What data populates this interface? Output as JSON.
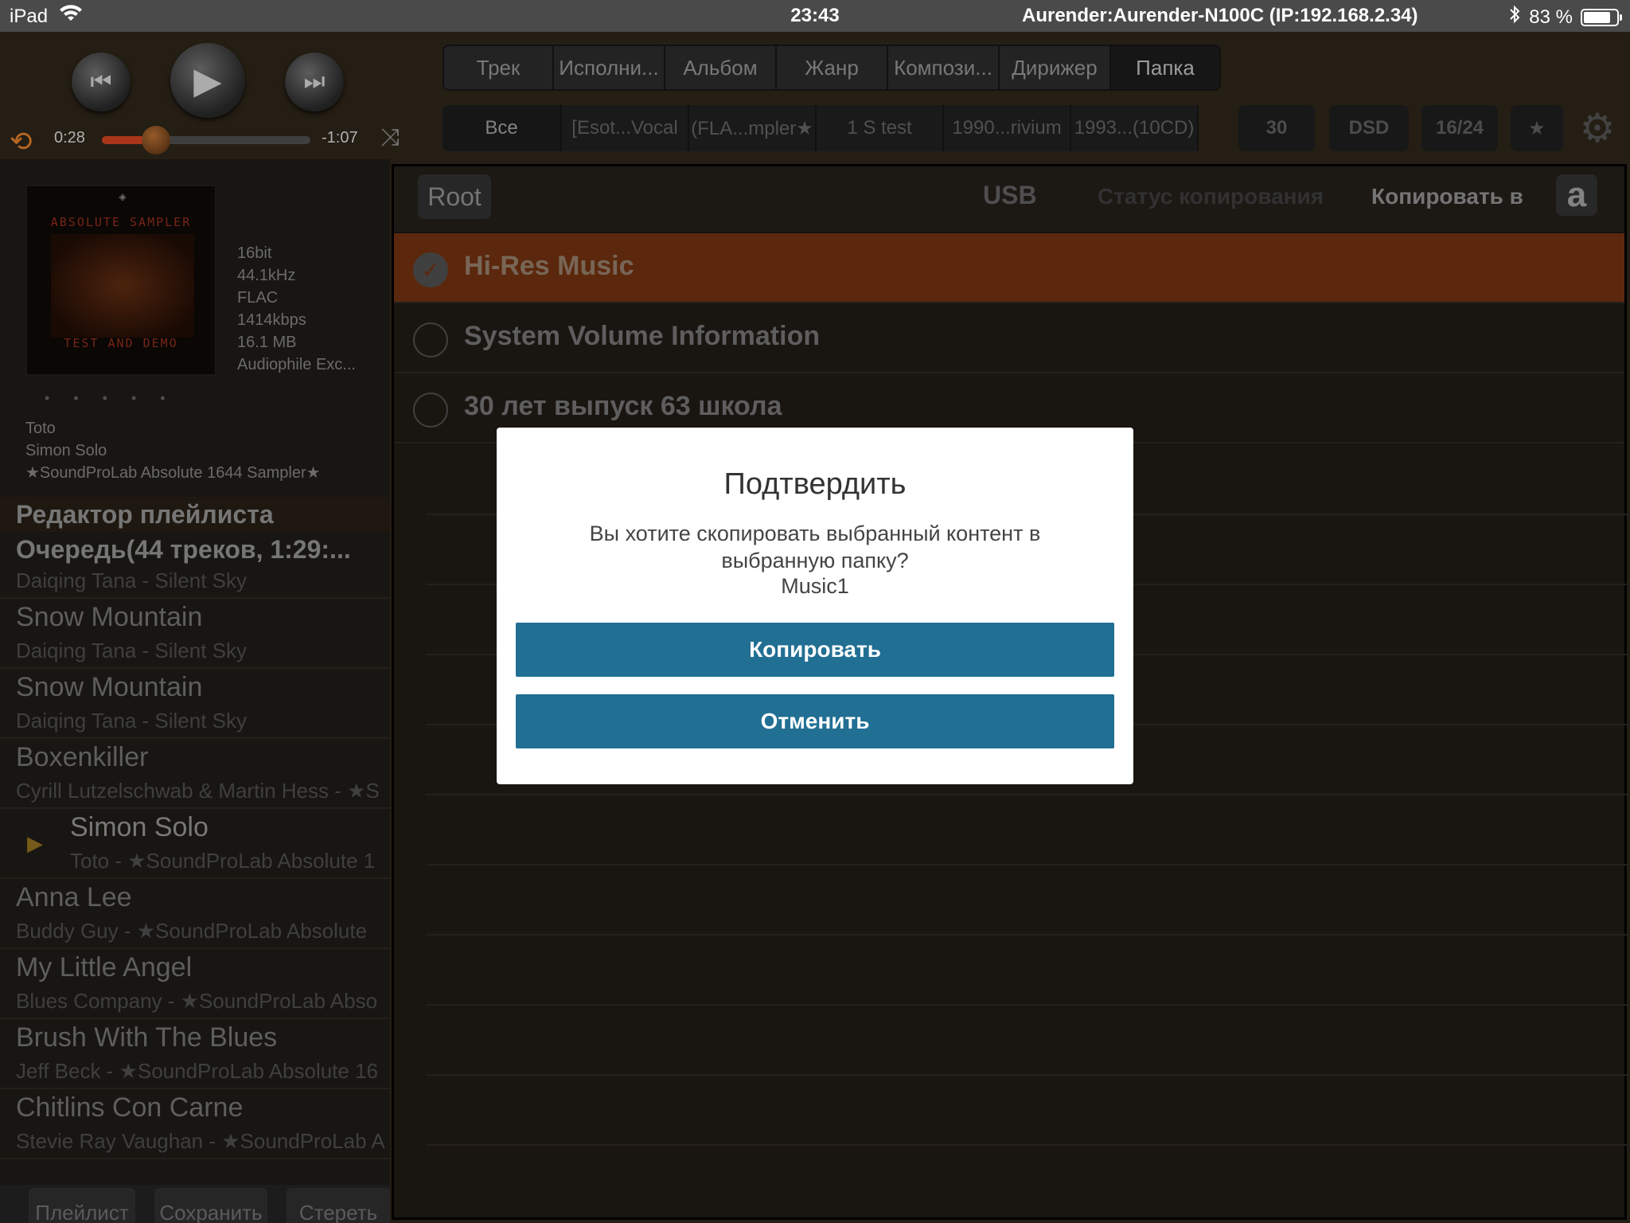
{
  "status_bar": {
    "device": "iPad",
    "time": "23:43",
    "connection": "Aurender:Aurender-N100C (IP:192.168.2.34)",
    "battery": "83 %",
    "battery_level": 0.83
  },
  "player": {
    "elapsed": "0:28",
    "remaining": "-1:07",
    "progress": 0.26
  },
  "category_tabs": [
    {
      "label": "Трек",
      "active": false
    },
    {
      "label": "Исполни...",
      "active": false
    },
    {
      "label": "Альбом",
      "active": false
    },
    {
      "label": "Жанр",
      "active": false
    },
    {
      "label": "Компози...",
      "active": false
    },
    {
      "label": "Дирижер",
      "active": false
    },
    {
      "label": "Папка",
      "active": true
    }
  ],
  "filters": {
    "items": [
      "Все",
      "[Esot...Vocal",
      "(FLA...mpler★",
      "1 S test",
      "1990...rivium",
      "1993...(10CD)"
    ],
    "badges": [
      "30",
      "DSD",
      "16/24",
      "★"
    ]
  },
  "now_playing": {
    "album_art": {
      "top_text": "ABSOLUTE SAMPLER",
      "bottom_text": "TEST AND DEMO"
    },
    "meta": [
      "16bit",
      "44.1kHz",
      "FLAC",
      "1414kbps",
      "16.1 MB",
      "Audiophile Exc..."
    ],
    "artist": "Toto",
    "title": "Simon Solo",
    "album": "★SoundProLab Absolute 1644 Sampler★"
  },
  "playlist": {
    "header": "Редактор плейлиста",
    "queue_header": "Очередь(44 треков, 1:29:...",
    "first_subtitle": "Daiqing Tana - Silent Sky",
    "tracks": [
      {
        "title": "Snow Mountain",
        "subtitle": "Daiqing Tana - Silent Sky",
        "playing": false
      },
      {
        "title": "Snow Mountain",
        "subtitle": "Daiqing Tana - Silent Sky",
        "playing": false
      },
      {
        "title": "Boxenkiller",
        "subtitle": "Cyrill Lutzelschwab & Martin Hess - ★S",
        "playing": false
      },
      {
        "title": "Simon Solo",
        "subtitle": "Toto - ★SoundProLab Absolute 1",
        "playing": true
      },
      {
        "title": "Anna Lee",
        "subtitle": "Buddy Guy - ★SoundProLab Absolute",
        "playing": false
      },
      {
        "title": "My Little Angel",
        "subtitle": "Blues Company - ★SoundProLab Abso",
        "playing": false
      },
      {
        "title": "Brush With The Blues",
        "subtitle": "Jeff Beck - ★SoundProLab Absolute 16",
        "playing": false
      },
      {
        "title": "Chitlins Con Carne",
        "subtitle": "Stevie Ray Vaughan - ★SoundProLab A",
        "playing": false
      }
    ],
    "buttons": {
      "playlist": "Плейлист",
      "save": "Сохранить",
      "clear": "Стереть"
    }
  },
  "folder_browser": {
    "back_label": "Root",
    "source": "USB",
    "copy_status": "Статус копирования",
    "copy_to": "Копировать в",
    "amazon_glyph": "a",
    "folders": [
      {
        "name": "Hi-Res Music",
        "selected": true
      },
      {
        "name": "System Volume Information",
        "selected": false
      },
      {
        "name": "30 лет выпуск 63 школа",
        "selected": false
      }
    ]
  },
  "dialog": {
    "title": "Подтвердить",
    "message": "Вы хотите скопировать выбранный контент в выбранную папку?",
    "folder": "Music1",
    "confirm_label": "Копировать",
    "cancel_label": "Отменить"
  },
  "colors": {
    "accent_orange": "#d87a2a",
    "selected_row": "#6b2f10",
    "dialog_button": "#216f93"
  }
}
